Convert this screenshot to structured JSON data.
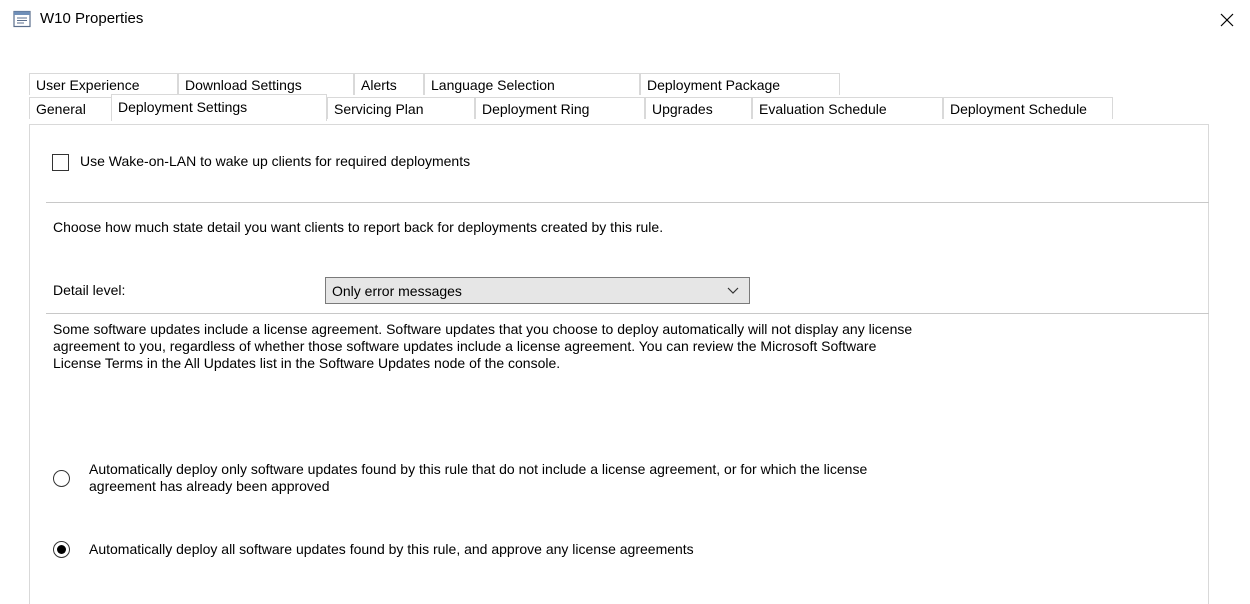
{
  "window": {
    "title": "W10 Properties",
    "close_glyph": "✕"
  },
  "tabs": {
    "row1": [
      "User Experience",
      "Download Settings",
      "Alerts",
      "Language Selection",
      "Deployment Package"
    ],
    "row2": [
      "General",
      "Deployment Settings",
      "Servicing Plan",
      "Deployment Ring",
      "Upgrades",
      "Evaluation Schedule",
      "Deployment Schedule"
    ],
    "active": "Deployment Settings"
  },
  "wake_on_lan": {
    "label": "Use Wake-on-LAN to wake up clients for required deployments",
    "checked": false
  },
  "state_detail": {
    "description": "Choose how much state detail you want clients to report back for deployments created by this rule.",
    "detail_label": "Detail level:",
    "detail_value": "Only error messages"
  },
  "license": {
    "paragraph_line1": "Some software updates include a license agreement. Software updates that you choose to deploy automatically will not display any license",
    "paragraph_line2": "agreement to you, regardless of whether those software updates include a license agreement. You can review the Microsoft Software",
    "paragraph_line3": "License Terms in the All Updates list in the Software Updates node of the console.",
    "option1_line1": "Automatically deploy only software updates found by this rule that do not include a license agreement, or for which the license",
    "option1_line2": "agreement has already been approved",
    "option2": "Automatically deploy all software updates found by this rule, and approve any license agreements",
    "selected": "option2"
  },
  "colors": {
    "tab_border": "#d9d9d9",
    "combo_bg": "#e6e6e6"
  },
  "icons": {
    "app": "properties-window-icon",
    "close": "close-icon",
    "dropdown": "chevron-down-icon"
  }
}
